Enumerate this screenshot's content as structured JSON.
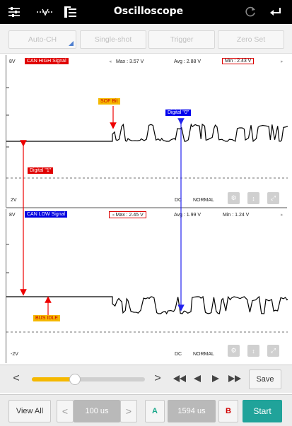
{
  "header": {
    "title": "Oscilloscope",
    "icons": [
      "sliders-icon",
      "wave-adjust-icon",
      "file-list-icon",
      "refresh-icon",
      "back-icon"
    ]
  },
  "modes": {
    "auto_ch": "Auto-CH",
    "single_shot": "Single-shot",
    "trigger": "Trigger",
    "zero_set": "Zero Set"
  },
  "channel1": {
    "scale_top": "8V",
    "scale_bottom": "2V",
    "name": "CAN HIGH Signal",
    "max": "Max : 3.57 V",
    "avg": "Avg : 2.88 V",
    "min": "Min : 2.43 V",
    "coupling": "DC",
    "mode": "NORMAL",
    "annot_sof": "SOF Bit",
    "annot_digital0": "Digital \"0\"",
    "annot_digital1": "Digital \"1\""
  },
  "channel2": {
    "scale_top": "8V",
    "scale_bottom": "-2V",
    "name": "CAN LOW Signal",
    "max": "Max : 2.45 V",
    "avg": "Avg : 1.99 V",
    "min": "Min : 1.24 V",
    "coupling": "DC",
    "mode": "NORMAL",
    "annot_bus_idle": "BUS IDLE"
  },
  "playback": {
    "prev": "<",
    "next": ">",
    "save": "Save",
    "slider_position": 0.38
  },
  "bottom": {
    "view_all": "View All",
    "time_div": "100 us",
    "cursor_a": "A",
    "cursor_time": "1594 us",
    "cursor_b": "B",
    "start": "Start"
  },
  "colors": {
    "header_bg": "#000000",
    "ch1_tag": "#e00000",
    "ch2_tag": "#0000e0",
    "sof_tag": "#f5b800",
    "bus_idle_tag": "#f5b800",
    "digital0_tag": "#0000ee",
    "digital1_tag": "#e00000",
    "cursor_a": "#1aa88a",
    "cursor_b": "#d00000",
    "start_button": "#20a39a",
    "slider_fill": "#f5b800"
  }
}
